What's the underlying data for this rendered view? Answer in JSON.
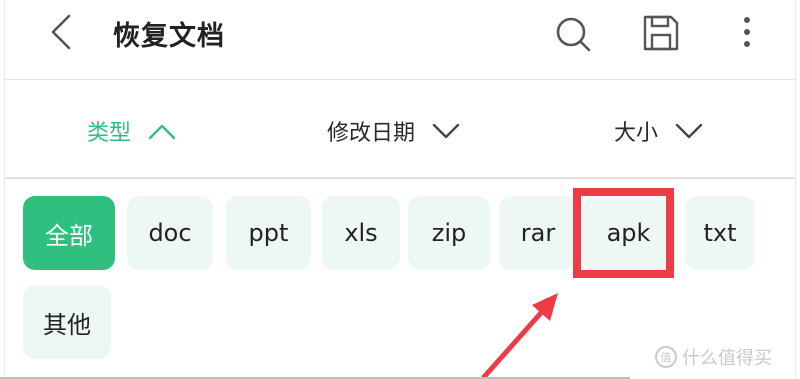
{
  "header": {
    "title": "恢复文档",
    "icons": [
      "back-arrow-icon",
      "search-icon",
      "save-icon",
      "more-vertical-icon"
    ]
  },
  "sort": {
    "type_label": "类型",
    "date_label": "修改日期",
    "size_label": "大小",
    "accent_color": "#2fbf7f"
  },
  "filters": {
    "chips": [
      "全部",
      "doc",
      "ppt",
      "xls",
      "zip",
      "rar",
      "apk",
      "txt",
      "其他"
    ],
    "active": "全部",
    "highlighted": "apk",
    "highlight_color": "#ee3b46"
  },
  "watermark": {
    "text": "什么值得买"
  }
}
